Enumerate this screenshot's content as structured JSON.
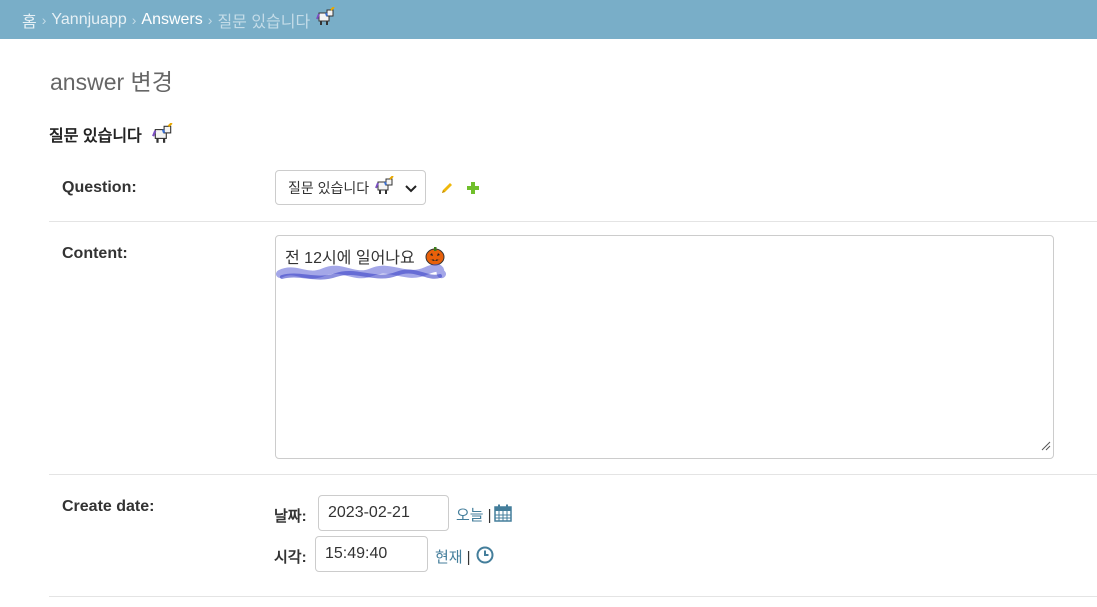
{
  "breadcrumbs": {
    "home": "홈",
    "app": "Yannjuapp",
    "model": "Answers",
    "current": "질문 있습니다"
  },
  "page": {
    "title": "answer 변경",
    "object_title": "질문 있습니다"
  },
  "form": {
    "question": {
      "label": "Question:",
      "selected": "질문 있습니다"
    },
    "content": {
      "label": "Content:",
      "value": "전 12시에 일어나요"
    },
    "create_date": {
      "label": "Create date:",
      "date_label": "날짜:",
      "date_value": "2023-02-21",
      "today_link": "오늘",
      "time_label": "시각:",
      "time_value": "15:49:40",
      "now_link": "현재",
      "separator": "|"
    }
  },
  "icons": {
    "unicorn": "unicorn-emoji-icon",
    "pumpkin": "jack-o-lantern-icon",
    "edit": "pencil-icon",
    "add": "plus-icon",
    "calendar": "calendar-icon",
    "clock": "clock-icon"
  },
  "colors": {
    "header_bg": "#79aec8",
    "link": "#447e9b",
    "edit_icon": "#efb80b",
    "add_icon": "#70bf2b"
  }
}
